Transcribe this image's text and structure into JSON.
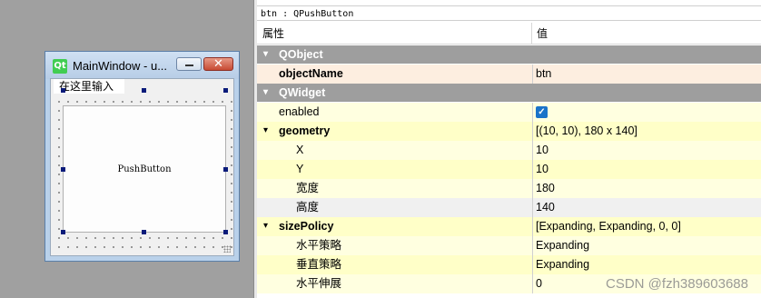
{
  "form_window": {
    "logo_text": "Qt",
    "title": "MainWindow - u...",
    "close_glyph": "✕",
    "menu_item": "在这里输入",
    "push_button_label": "PushButton"
  },
  "property_editor": {
    "object_label": "btn : QPushButton",
    "header": {
      "property": "属性",
      "value": "值"
    },
    "rows": [
      {
        "kind": "category",
        "name": "QObject",
        "expander": "▾"
      },
      {
        "kind": "prop",
        "name": "objectName",
        "value": "btn",
        "bold": true,
        "indent": 0,
        "bg": "#fdeee0"
      },
      {
        "kind": "category",
        "name": "QWidget",
        "expander": "▾"
      },
      {
        "kind": "prop",
        "name": "enabled",
        "value": "",
        "checkbox": true,
        "indent": 0,
        "bg": "#ffffe0"
      },
      {
        "kind": "prop",
        "name": "geometry",
        "value": "[(10, 10), 180 x 140]",
        "bold": true,
        "expander": "▾",
        "indent": 0,
        "bg": "#ffffc8"
      },
      {
        "kind": "prop",
        "name": "X",
        "value": "10",
        "indent": 1,
        "bg": "#ffffe0"
      },
      {
        "kind": "prop",
        "name": "Y",
        "value": "10",
        "indent": 1,
        "bg": "#ffffc8"
      },
      {
        "kind": "prop",
        "name": "宽度",
        "value": "180",
        "indent": 1,
        "bg": "#ffffe0"
      },
      {
        "kind": "prop",
        "name": "高度",
        "value": "140",
        "indent": 1,
        "bg": "#f0f0f0"
      },
      {
        "kind": "prop",
        "name": "sizePolicy",
        "value": "[Expanding, Expanding, 0, 0]",
        "bold": true,
        "expander": "▾",
        "indent": 0,
        "bg": "#ffffc8"
      },
      {
        "kind": "prop",
        "name": "水平策略",
        "value": "Expanding",
        "indent": 1,
        "bg": "#ffffe0"
      },
      {
        "kind": "prop",
        "name": "垂直策略",
        "value": "Expanding",
        "indent": 1,
        "bg": "#ffffc8"
      },
      {
        "kind": "prop",
        "name": "水平伸展",
        "value": "0",
        "indent": 1,
        "bg": "#ffffe0"
      }
    ],
    "checkmark": "✓"
  },
  "watermark": "CSDN @fzh389603688",
  "colors": {
    "category_bg": "#9e9e9e",
    "qt_green": "#41cd52",
    "checkbox_blue": "#1a73c9"
  }
}
